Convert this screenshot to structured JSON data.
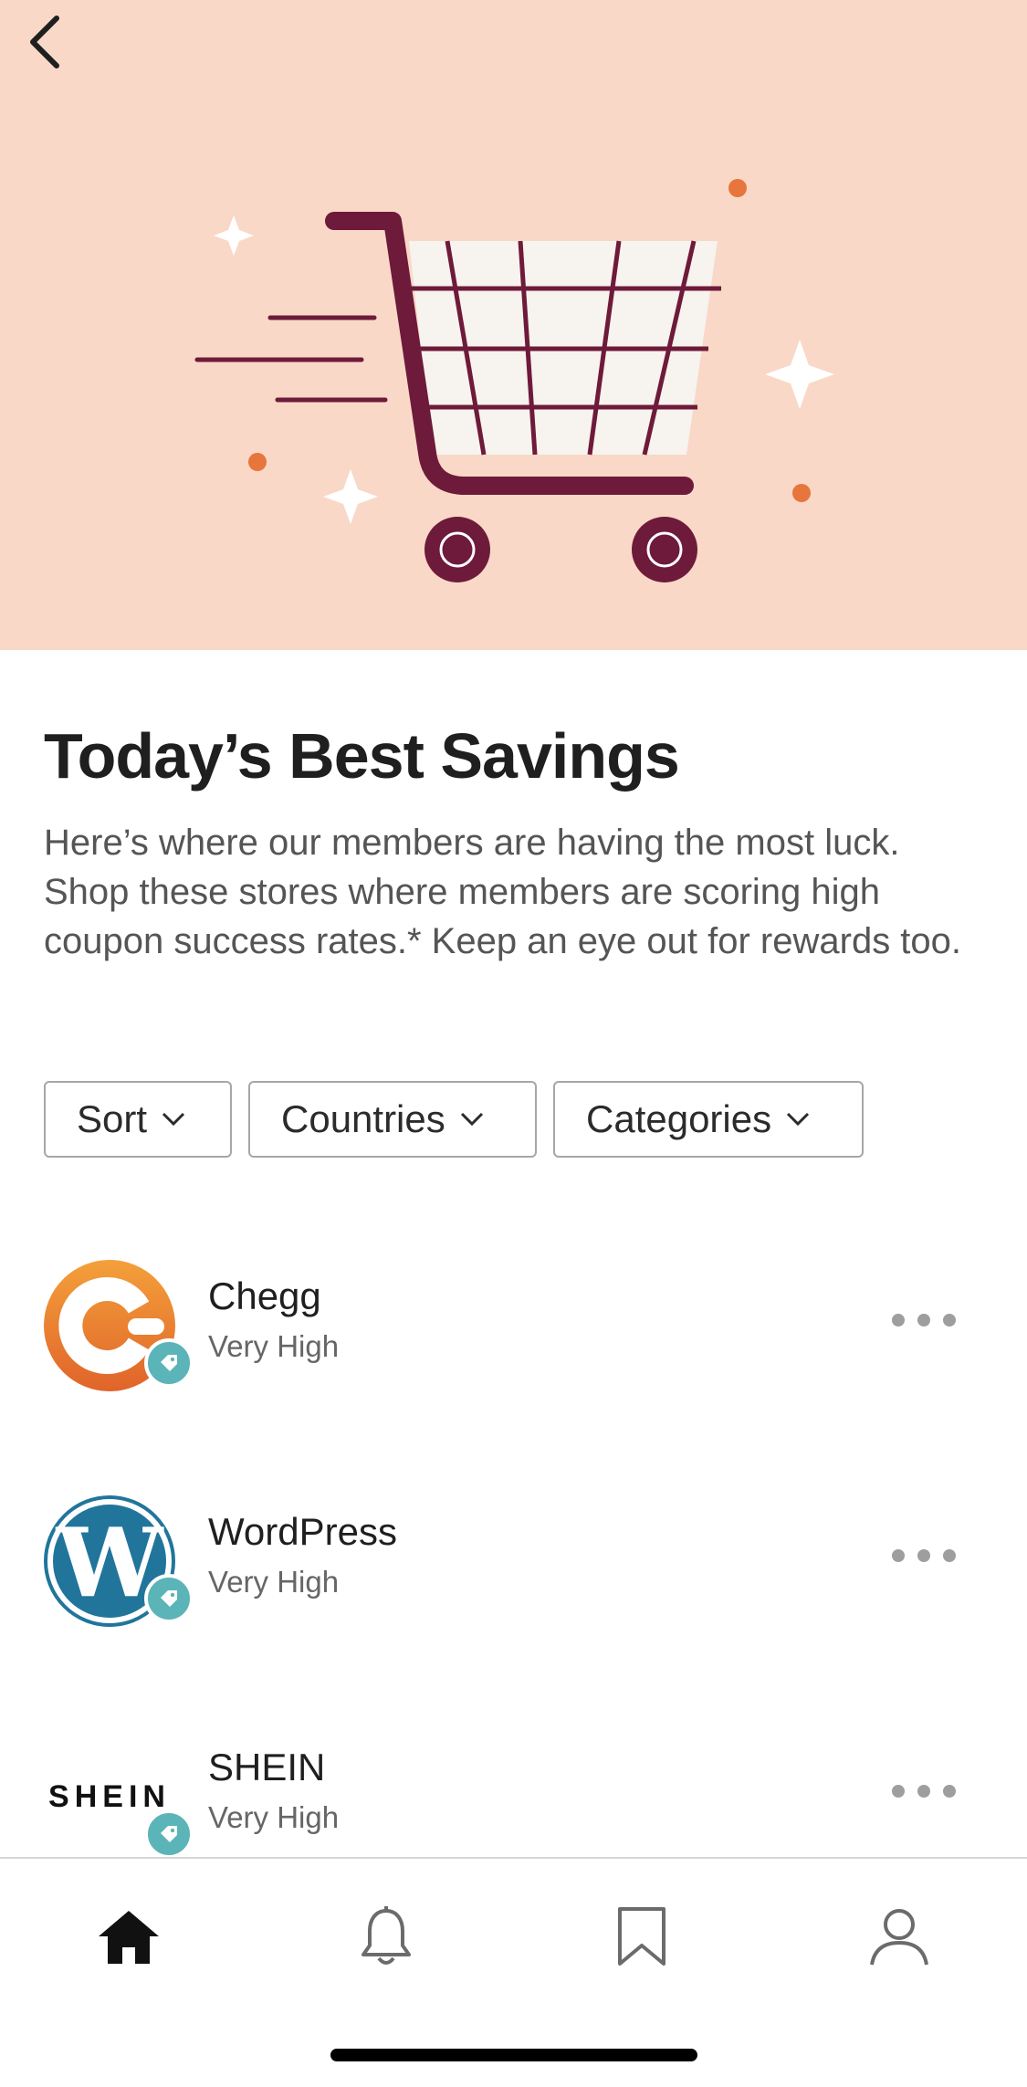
{
  "nav": {
    "back_icon": "chevron-left-icon"
  },
  "hero": {
    "background": "#f9d8c7",
    "illustration": "shopping-cart-icon",
    "cart_color": "#6e1a3a",
    "accent": "#e7763c"
  },
  "header": {
    "title": "Today’s Best Savings",
    "description": "Here’s where our members are having the most luck. Shop these stores where members are scoring high coupon success rates.* Keep an eye out for rewards too."
  },
  "filters": [
    {
      "label": "Sort"
    },
    {
      "label": "Countries"
    },
    {
      "label": "Categories"
    }
  ],
  "stores": [
    {
      "name": "Chegg",
      "rate": "Very High",
      "logo": "chegg-logo"
    },
    {
      "name": "WordPress",
      "rate": "Very High",
      "logo": "wordpress-logo"
    },
    {
      "name": "SHEIN",
      "rate": "Very High",
      "logo": "shein-logo",
      "logo_text": "SHEIN"
    }
  ],
  "tabbar": {
    "items": [
      {
        "icon": "home-icon",
        "active": true
      },
      {
        "icon": "bell-icon",
        "active": false
      },
      {
        "icon": "bookmark-icon",
        "active": false
      },
      {
        "icon": "profile-icon",
        "active": false
      }
    ]
  },
  "colors": {
    "badge": "#5bb4b8",
    "chegg": "#e8762d",
    "wordpress": "#21759b"
  }
}
